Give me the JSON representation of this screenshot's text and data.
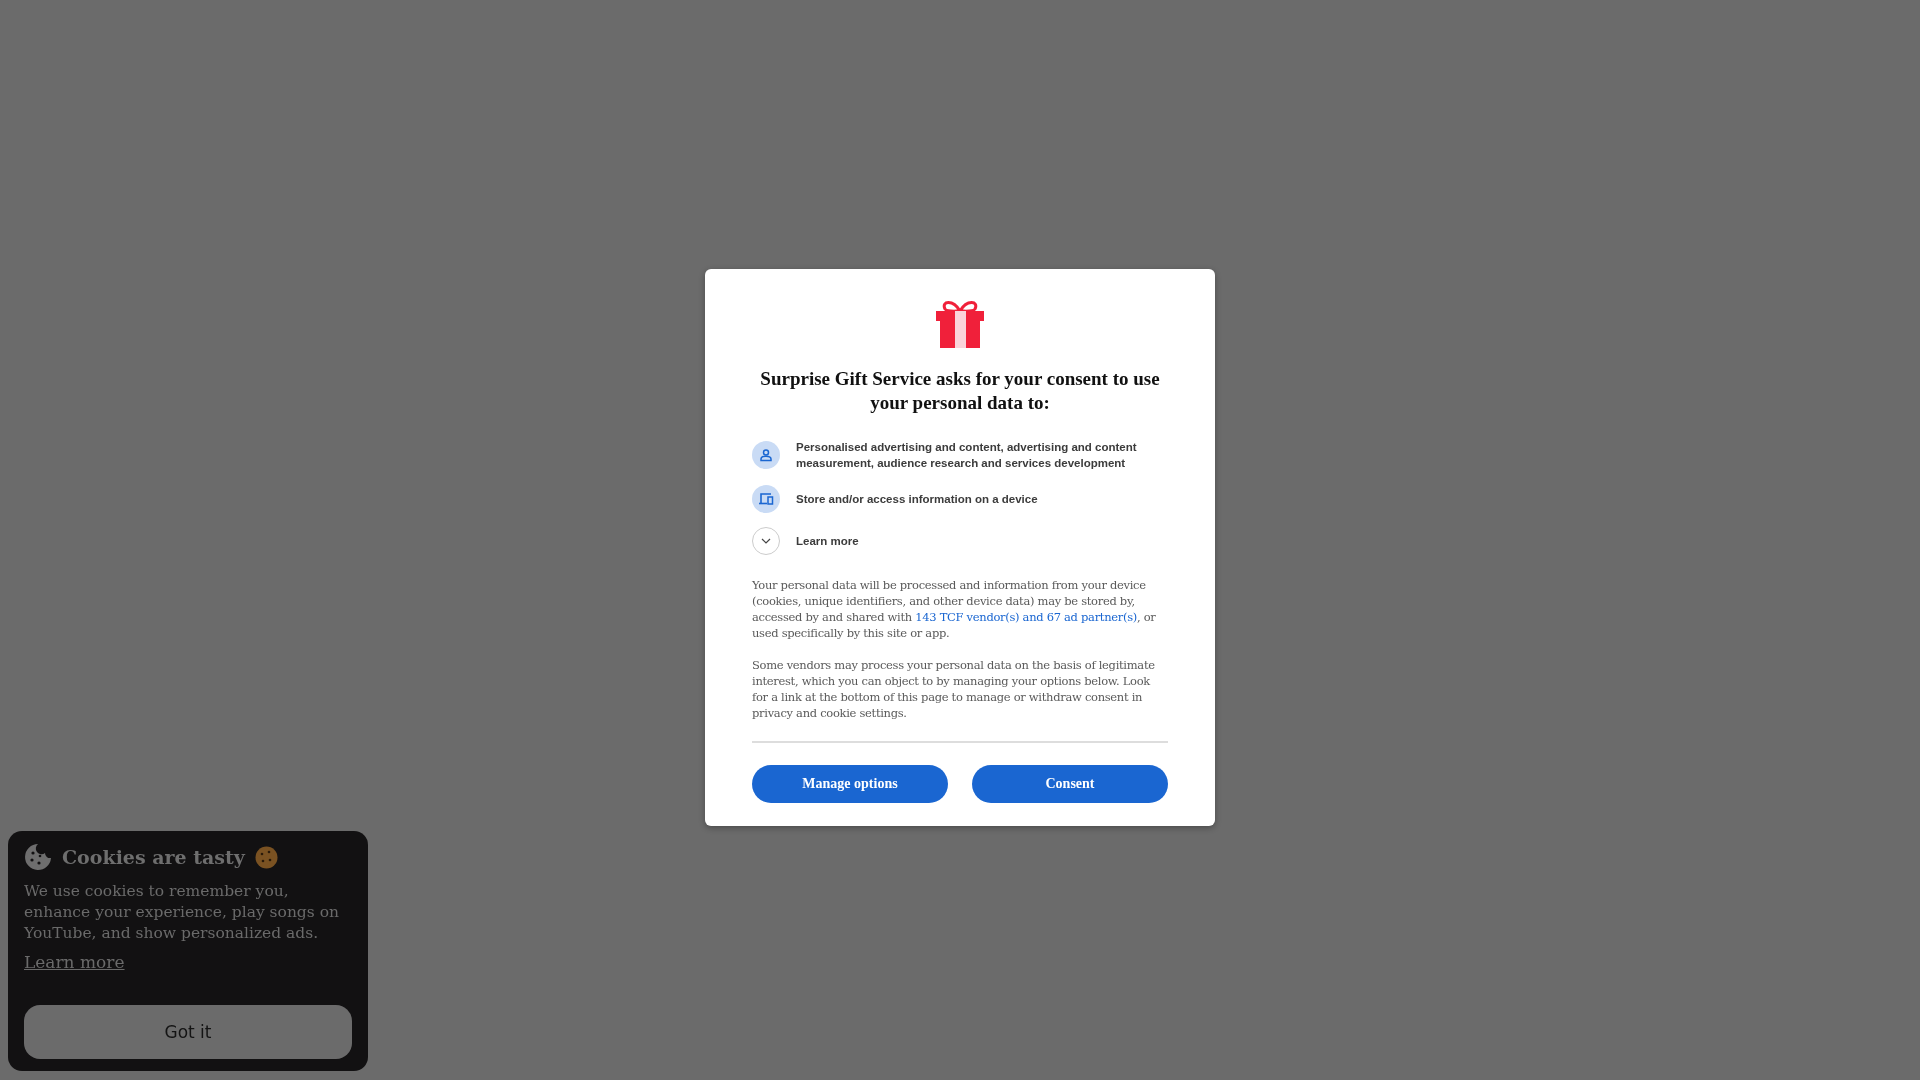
{
  "consent_dialog": {
    "title": "Surprise Gift Service asks for your consent to use your personal data to:",
    "purposes": [
      {
        "kind": "person",
        "text": "Personalised advertising and content, advertising and content measurement, audience research and services development"
      },
      {
        "kind": "devices",
        "text": "Store and/or access information on a device"
      },
      {
        "kind": "expander",
        "text": "Learn more",
        "expanded": false
      }
    ],
    "paragraphs": [
      {
        "before": "Your personal data will be processed and information from your device (cookies, unique identifiers, and other device data) may be stored by, accessed by and shared with ",
        "link": "143 TCF vendor(s) and 67 ad partner(s)",
        "after": ", or used specifically by this site or app."
      },
      {
        "before": "Some vendors may process your personal data on the basis of legitimate interest, which you can object to by managing your options below. Look for a link at the bottom of this page to manage or withdraw consent in privacy and cookie settings."
      }
    ],
    "buttons": [
      "Manage options",
      "Consent"
    ]
  },
  "cookie_banner": {
    "title": "Cookies are tasty",
    "text": "We use cookies to remember you, enhance your experience, play songs on YouTube, and show personalized ads.",
    "link": "Learn more",
    "button": "Got it"
  }
}
